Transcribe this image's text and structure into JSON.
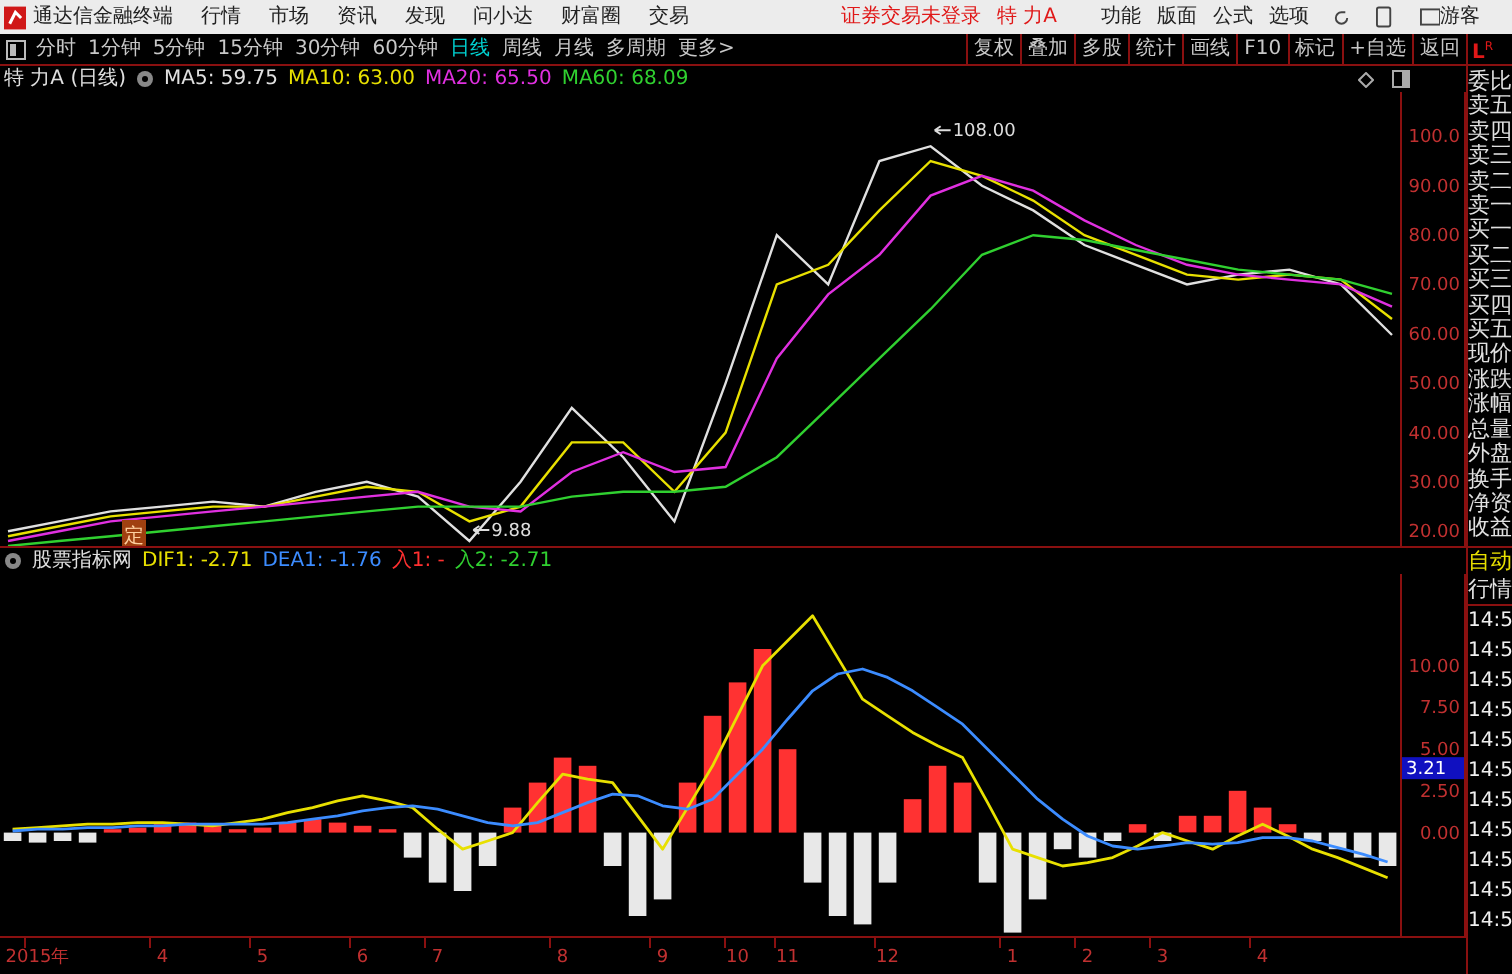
{
  "menubar": {
    "app_title": "通达信金融终端",
    "menus": [
      "行情",
      "市场",
      "资讯",
      "发现",
      "问小达",
      "财富圈",
      "交易"
    ],
    "login_status": "证券交易未登录",
    "stock": "特 力A",
    "right_menus": [
      "功能",
      "版面",
      "公式",
      "选项"
    ],
    "user": "游客"
  },
  "toolbar": {
    "periods": [
      {
        "label": "分时",
        "selected": false
      },
      {
        "label": "1分钟",
        "selected": false
      },
      {
        "label": "5分钟",
        "selected": false
      },
      {
        "label": "15分钟",
        "selected": false
      },
      {
        "label": "30分钟",
        "selected": false
      },
      {
        "label": "60分钟",
        "selected": false
      },
      {
        "label": "日线",
        "selected": true
      },
      {
        "label": "周线",
        "selected": false
      },
      {
        "label": "月线",
        "selected": false
      },
      {
        "label": "多周期",
        "selected": false
      },
      {
        "label": "更多>",
        "selected": false
      }
    ],
    "buttons": [
      "复权",
      "叠加",
      "多股",
      "统计",
      "画线",
      "F10",
      "标记",
      "+自选",
      "返回"
    ],
    "corner": [
      "L",
      "R"
    ]
  },
  "price_panel": {
    "title": "特 力A (日线)",
    "legend_values": [
      ": 59.75",
      ": 63.00",
      ": 65.50",
      ": 68.09"
    ],
    "signal_marks": [
      {
        "label": "定"
      }
    ],
    "chart_data": {
      "type": "line",
      "categories": [
        null,
        null,
        null,
        null,
        null,
        null,
        null,
        null,
        null,
        null,
        null,
        null,
        null,
        null,
        null,
        null,
        null,
        null,
        null,
        null,
        null,
        null,
        null,
        null,
        null,
        null,
        null,
        null
      ],
      "ylim": [
        17,
        109
      ],
      "yticks": [
        {
          "value": 20,
          "label": "20.00"
        },
        {
          "value": 30,
          "label": "30.00"
        },
        {
          "value": 40,
          "label": "40.00"
        },
        {
          "value": 50,
          "label": "50.00"
        },
        {
          "value": 60,
          "label": "60.00"
        },
        {
          "value": 70,
          "label": "70.00"
        },
        {
          "value": 80,
          "label": "80.00"
        },
        {
          "value": 90,
          "label": "90.00"
        },
        {
          "value": 100,
          "label": "100.0"
        }
      ],
      "series": [
        {
          "name": "MA5",
          "color": "#e0e0e0",
          "values": [
            20,
            22,
            24,
            25,
            26,
            25,
            28,
            30,
            27,
            18,
            30,
            45,
            35,
            22,
            50,
            80,
            70,
            95,
            98,
            90,
            85,
            78,
            74,
            70,
            72,
            73,
            70,
            59.75
          ]
        },
        {
          "name": "MA10",
          "color": "#e8e000",
          "values": [
            19,
            21,
            23,
            24,
            25,
            25,
            27,
            29,
            28,
            22,
            25,
            38,
            38,
            28,
            40,
            70,
            74,
            85,
            95,
            92,
            87,
            80,
            76,
            72,
            71,
            72,
            71,
            63
          ]
        },
        {
          "name": "MA20",
          "color": "#e030e0",
          "values": [
            18,
            20,
            22,
            23,
            24,
            25,
            26,
            27,
            28,
            25,
            24,
            32,
            36,
            32,
            33,
            55,
            68,
            76,
            88,
            92,
            89,
            83,
            78,
            74,
            72,
            71,
            70,
            65.5
          ]
        },
        {
          "name": "MA60",
          "color": "#30d030",
          "values": [
            17,
            18,
            19,
            20,
            21,
            22,
            23,
            24,
            25,
            25,
            25,
            27,
            28,
            28,
            29,
            35,
            45,
            55,
            65,
            76,
            80,
            79,
            77,
            75,
            73,
            72,
            71,
            68.09
          ]
        }
      ],
      "annotations": [
        {
          "text": "108.00"
        },
        {
          "text": "9.88"
        }
      ]
    }
  },
  "macd_panel": {
    "title": "股票指标网",
    "legend_values": [
      ": -2.71",
      ": -1.76"
    ],
    "extra_legend": [
      {
        "label": "入1: -",
        "color": "#ff3030"
      },
      {
        "label": "入2: -2.71",
        "color": "#30d030"
      }
    ],
    "current_value": "3.21",
    "chart_data": {
      "type": "bar",
      "stacked": true,
      "categories": [
        null,
        "2015年",
        null,
        null,
        null,
        null,
        "4",
        null,
        null,
        null,
        "5",
        null,
        null,
        null,
        "6",
        null,
        null,
        "7",
        null,
        null,
        null,
        null,
        "8",
        null,
        null,
        null,
        "9",
        null,
        null,
        "10",
        null,
        "11",
        null,
        null,
        null,
        "12",
        null,
        null,
        null,
        null,
        "1",
        null,
        null,
        "2",
        null,
        null,
        "3",
        null,
        null,
        null,
        "4",
        null,
        null,
        null,
        null,
        null
      ],
      "ylim": [
        -6.2,
        15.5
      ],
      "yticks": [
        {
          "value": 0,
          "label": "0.00"
        },
        {
          "value": 2.5,
          "label": "2.50"
        },
        {
          "value": 5,
          "label": "5.00"
        },
        {
          "value": 7.5,
          "label": "7.50"
        },
        {
          "value": 10,
          "label": "10.00"
        }
      ],
      "series": [
        {
          "type": "bar",
          "color": "#ff3232",
          "values": [
            null,
            null,
            null,
            null,
            0.2,
            0.3,
            0.5,
            0.6,
            0.4,
            0.2,
            0.3,
            0.6,
            0.8,
            0.6,
            0.4,
            0.2,
            null,
            null,
            null,
            null,
            1.5,
            3,
            4.5,
            4,
            null,
            null,
            null,
            3,
            7,
            9,
            11,
            5,
            null,
            null,
            null,
            null,
            2,
            4,
            3,
            null,
            null,
            null,
            null,
            null,
            null,
            0.5,
            null,
            1,
            1,
            2.5,
            1.5,
            0.5,
            null,
            null,
            null,
            null
          ]
        },
        {
          "type": "bar",
          "color": "#e8e8e8",
          "values": [
            -0.5,
            -0.6,
            -0.5,
            -0.6,
            null,
            null,
            null,
            null,
            null,
            null,
            null,
            null,
            null,
            null,
            null,
            null,
            -1.5,
            -3,
            -3.5,
            -2,
            null,
            null,
            null,
            null,
            -2,
            -5,
            -4,
            null,
            null,
            null,
            null,
            null,
            -3,
            -5,
            -5.5,
            -3,
            null,
            null,
            null,
            -3,
            -6,
            -4,
            -1,
            -1.5,
            -0.5,
            null,
            -0.5,
            null,
            null,
            null,
            null,
            null,
            -0.5,
            -1,
            -1.5,
            -2
          ]
        },
        {
          "name": "DIF1",
          "type": "line",
          "color": "#e8e000",
          "values": [
            0.2,
            0.3,
            0.4,
            0.5,
            0.5,
            0.6,
            0.6,
            0.5,
            0.4,
            0.6,
            0.8,
            1.2,
            1.5,
            1.9,
            2.2,
            1.9,
            1.5,
            0.2,
            -1,
            -0.5,
            0,
            1.8,
            3.5,
            3.2,
            3,
            1,
            -1,
            1.5,
            4,
            7,
            10,
            11.5,
            13,
            10.5,
            8,
            7,
            6,
            5.2,
            4.5,
            1.8,
            -1,
            -1.5,
            -2,
            -1.8,
            -1.5,
            -0.8,
            0,
            -0.5,
            -1,
            -0.2,
            0.5,
            -0.2,
            -1,
            -1.5,
            -2.1,
            -2.71
          ]
        },
        {
          "name": "DEA1",
          "type": "line",
          "color": "#3c8cff",
          "values": [
            0.1,
            0.2,
            0.2,
            0.3,
            0.3,
            0.4,
            0.4,
            0.5,
            0.5,
            0.5,
            0.5,
            0.6,
            0.8,
            1.0,
            1.3,
            1.5,
            1.6,
            1.4,
            1.0,
            0.6,
            0.4,
            0.6,
            1.2,
            1.8,
            2.3,
            2.2,
            1.6,
            1.4,
            2.0,
            3.5,
            5.0,
            6.8,
            8.5,
            9.5,
            9.8,
            9.3,
            8.5,
            7.5,
            6.5,
            5.0,
            3.5,
            2.0,
            0.8,
            -0.2,
            -0.8,
            -1.0,
            -0.8,
            -0.6,
            -0.7,
            -0.6,
            -0.3,
            -0.3,
            -0.5,
            -0.9,
            -1.3,
            -1.76
          ]
        }
      ]
    }
  },
  "quote_panel": {
    "fields": [
      "委比",
      "卖五",
      "卖四",
      "卖三",
      "卖二",
      "卖一",
      "买一",
      "买二",
      "买三",
      "买四",
      "买五",
      "现价",
      "涨跌",
      "涨幅",
      "总量",
      "外盘",
      "换手",
      "净资",
      "收益"
    ],
    "mode": "自动",
    "mode_label": "行情",
    "ticks": [
      "14:5",
      "14:5",
      "14:5",
      "14:5",
      "14:5",
      "14:5",
      "14:5",
      "14:5",
      "14:5",
      "14:5",
      "14:5"
    ]
  }
}
